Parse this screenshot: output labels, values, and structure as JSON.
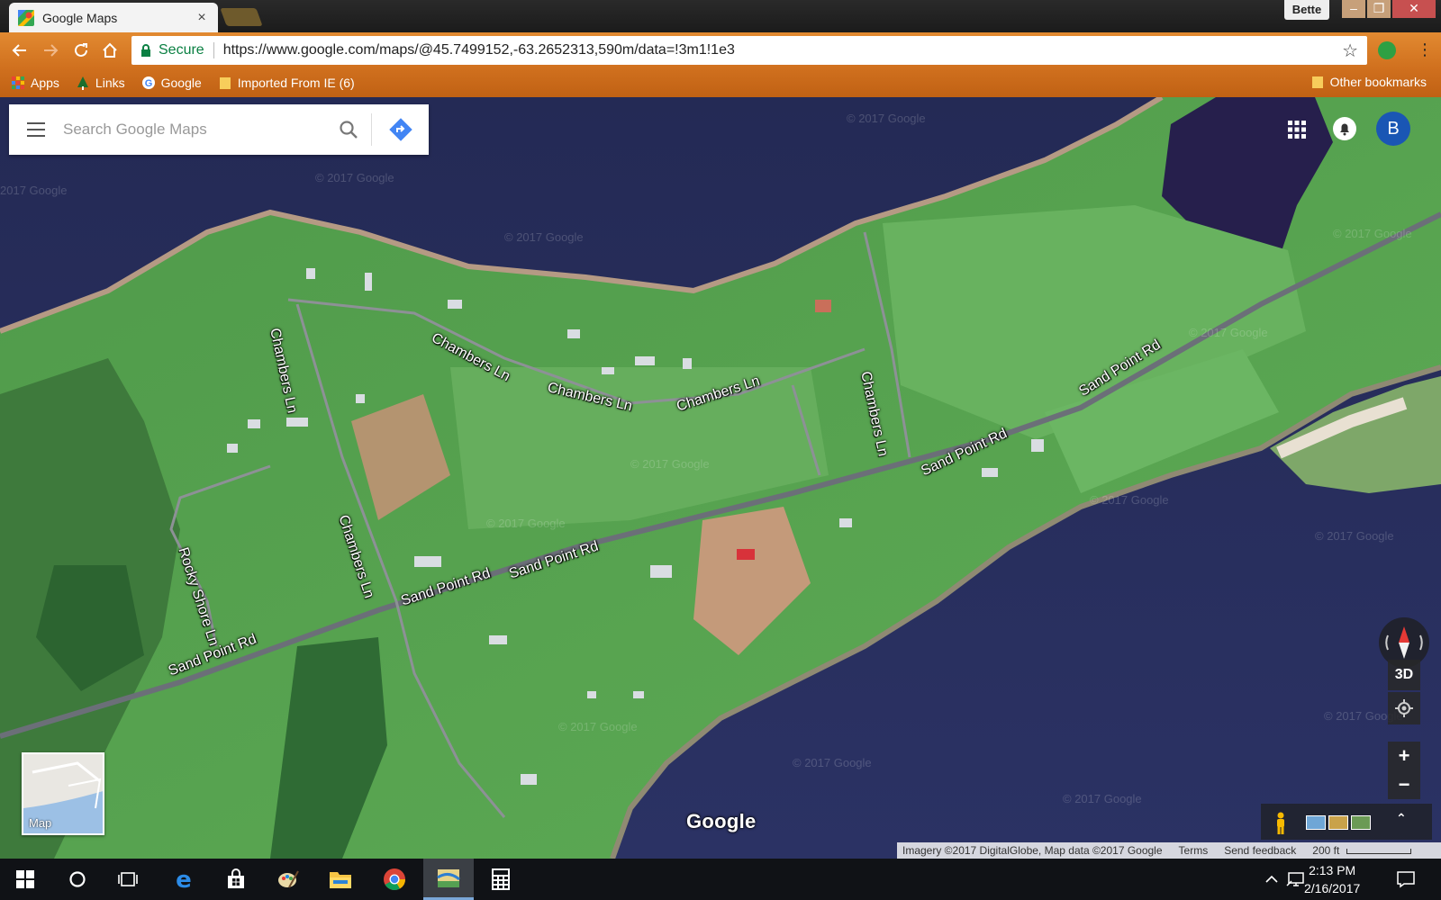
{
  "browser": {
    "profile_name": "Bette",
    "tab": {
      "title": "Google Maps",
      "close": "×"
    },
    "window_controls": {
      "minimize": "–",
      "restore": "❐",
      "close": "✕"
    },
    "address": {
      "secure_label": "Secure",
      "url": "https://www.google.com/maps/@45.7499152,-63.2652313,590m/data=!3m1!1e3"
    },
    "bookmarks": [
      {
        "label": "Apps",
        "icon": "apps-grid-icon"
      },
      {
        "label": "Links",
        "icon": "tree-icon"
      },
      {
        "label": "Google",
        "icon": "google-g-icon"
      },
      {
        "label": "Imported From IE (6)",
        "icon": "folder-icon"
      }
    ],
    "other_bookmarks": "Other bookmarks",
    "accent_color": "#d97a24"
  },
  "maps": {
    "search_placeholder": "Search Google Maps",
    "account_initial": "B",
    "logo_text": "Google",
    "minimap_label": "Map",
    "controls": {
      "three_d": "3D",
      "zoom_in": "+",
      "zoom_out": "−",
      "expand": "⌃"
    },
    "road_labels": {
      "chambers_1": "Chambers Ln",
      "chambers_2": "Chambers Ln",
      "chambers_3": "Chambers Ln",
      "chambers_4": "Chambers Ln",
      "chambers_5": "Chambers Ln",
      "chambers_6": "Chambers Ln",
      "sand_1": "Sand Point Rd",
      "sand_2": "Sand Point Rd",
      "sand_3": "Sand Point Rd",
      "sand_4": "Sand Point Rd",
      "sand_5": "Sand Point Rd",
      "rocky": "Rocky Shore Ln"
    },
    "attribution": {
      "imagery": "Imagery ©2017 DigitalGlobe, Map data ©2017 Google",
      "terms": "Terms",
      "feedback": "Send feedback",
      "scale": "200 ft"
    }
  },
  "taskbar": {
    "time": "2:13 PM",
    "date": "2/16/2017",
    "apps": [
      "start-icon",
      "cortana-icon",
      "task-view-icon",
      "edge-icon",
      "store-icon",
      "paint-icon",
      "file-explorer-icon",
      "chrome-icon",
      "maps-app-icon",
      "calculator-icon"
    ]
  }
}
